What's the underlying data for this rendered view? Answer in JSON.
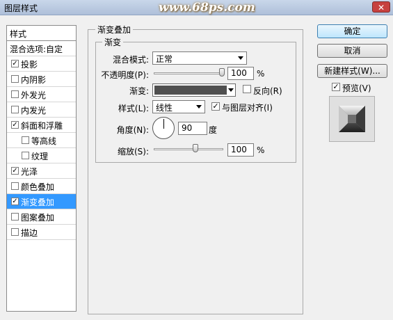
{
  "window": {
    "title": "图层样式",
    "watermark": "www.68ps.com",
    "close_label": "✕"
  },
  "styles_panel": {
    "header": "样式",
    "items": [
      {
        "label": "混合选项:自定",
        "checkbox": null,
        "checked": false,
        "sub": false,
        "selected": false
      },
      {
        "label": "投影",
        "checkbox": true,
        "checked": true,
        "sub": false,
        "selected": false
      },
      {
        "label": "内阴影",
        "checkbox": true,
        "checked": false,
        "sub": false,
        "selected": false
      },
      {
        "label": "外发光",
        "checkbox": true,
        "checked": false,
        "sub": false,
        "selected": false
      },
      {
        "label": "内发光",
        "checkbox": true,
        "checked": false,
        "sub": false,
        "selected": false
      },
      {
        "label": "斜面和浮雕",
        "checkbox": true,
        "checked": true,
        "sub": false,
        "selected": false
      },
      {
        "label": "等高线",
        "checkbox": true,
        "checked": false,
        "sub": true,
        "selected": false
      },
      {
        "label": "纹理",
        "checkbox": true,
        "checked": false,
        "sub": true,
        "selected": false
      },
      {
        "label": "光泽",
        "checkbox": true,
        "checked": true,
        "sub": false,
        "selected": false
      },
      {
        "label": "颜色叠加",
        "checkbox": true,
        "checked": false,
        "sub": false,
        "selected": false
      },
      {
        "label": "渐变叠加",
        "checkbox": true,
        "checked": true,
        "sub": false,
        "selected": true
      },
      {
        "label": "图案叠加",
        "checkbox": true,
        "checked": false,
        "sub": false,
        "selected": false
      },
      {
        "label": "描边",
        "checkbox": true,
        "checked": false,
        "sub": false,
        "selected": false
      }
    ]
  },
  "gradient_overlay": {
    "group_title": "渐变叠加",
    "inner_title": "渐变",
    "blend_mode_label": "混合模式:",
    "blend_mode_value": "正常",
    "opacity_label": "不透明度(P):",
    "opacity_value": "100",
    "opacity_level": 1.0,
    "percent": "%",
    "gradient_label": "渐变:",
    "gradient_color": "#4f4f4f",
    "reverse_label": "反向(R)",
    "reverse_checked": false,
    "style_label": "样式(L):",
    "style_value": "线性",
    "align_label": "与图层对齐(I)",
    "align_checked": true,
    "angle_label": "角度(N):",
    "angle_value": "90",
    "degree_unit": "度",
    "scale_label": "缩放(S):",
    "scale_value": "100",
    "scale_level": 0.6
  },
  "actions": {
    "ok": "确定",
    "cancel": "取消",
    "new_style": "新建样式(W)...",
    "preview_label": "预览(V)",
    "preview_checked": true
  },
  "checkmark": "✓"
}
